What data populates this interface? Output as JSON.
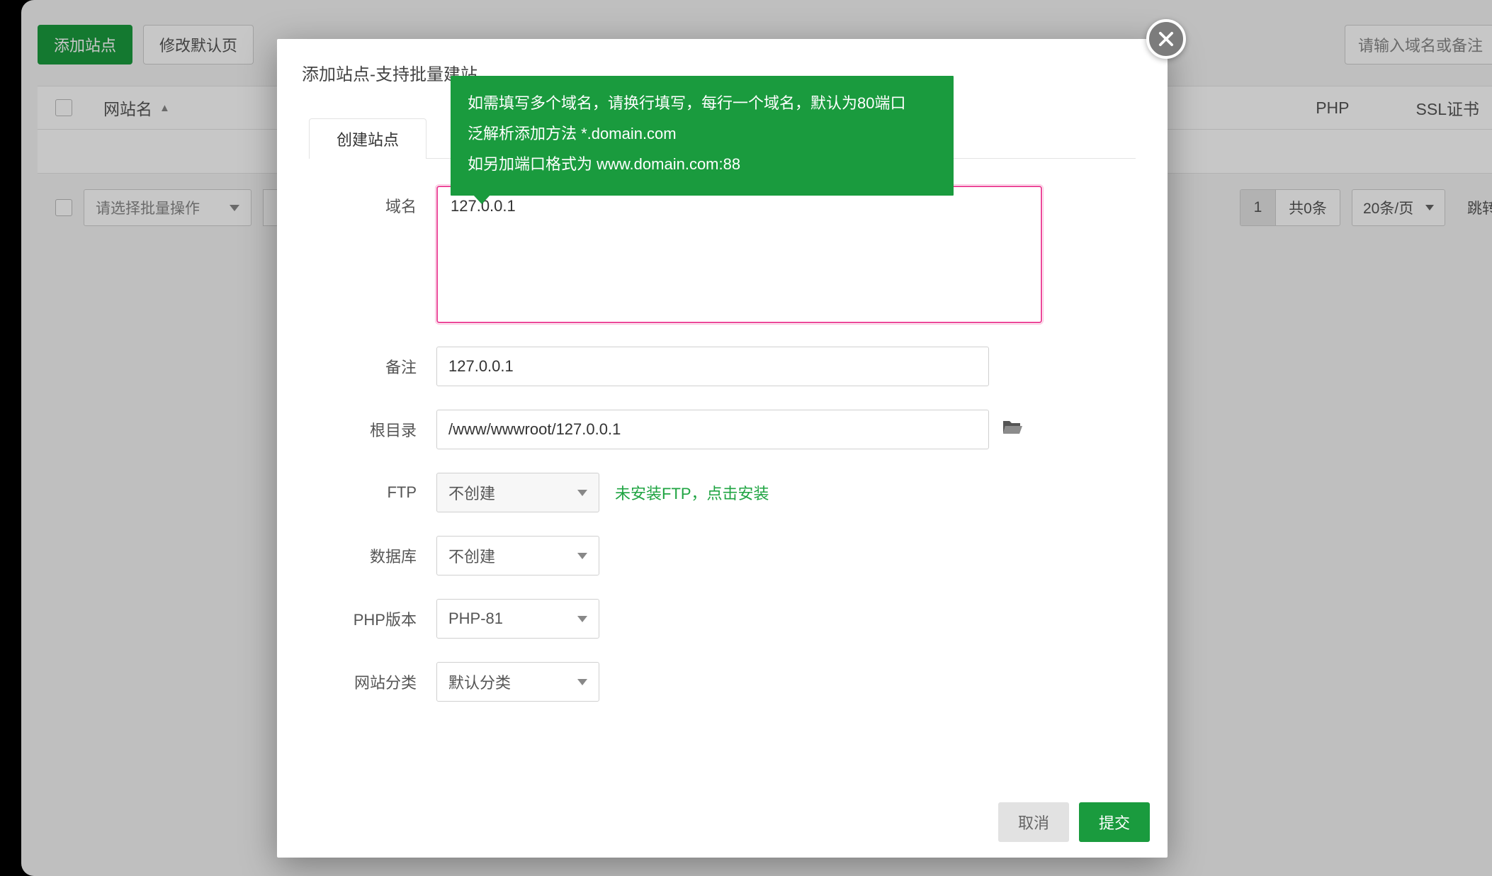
{
  "toolbar": {
    "add_site": "添加站点",
    "modify_default": "修改默认页",
    "search_placeholder": "请输入域名或备注"
  },
  "table": {
    "col_site_name": "网站名",
    "col_php": "PHP",
    "col_ssl": "SSL证书"
  },
  "footer": {
    "batch_placeholder": "请选择批量操作",
    "page_current": "1",
    "total": "共0条",
    "page_size": "20条/页",
    "jump": "跳转"
  },
  "modal": {
    "title": "添加站点-支持批量建站",
    "tabs": {
      "create_site": "创建站点"
    },
    "labels": {
      "domain": "域名",
      "remark": "备注",
      "root": "根目录",
      "ftp": "FTP",
      "db": "数据库",
      "php": "PHP版本",
      "category": "网站分类"
    },
    "values": {
      "domain": "127.0.0.1",
      "remark": "127.0.0.1",
      "root": "/www/wwwroot/127.0.0.1",
      "ftp": "不创建",
      "db": "不创建",
      "php": "PHP-81",
      "category": "默认分类"
    },
    "hint_ftp": "未安装FTP，点击安装",
    "buttons": {
      "cancel": "取消",
      "submit": "提交"
    }
  },
  "tooltip": {
    "line1": "如需填写多个域名，请换行填写，每行一个域名，默认为80端口",
    "line2": "泛解析添加方法 *.domain.com",
    "line3": "如另加端口格式为 www.domain.com:88"
  }
}
